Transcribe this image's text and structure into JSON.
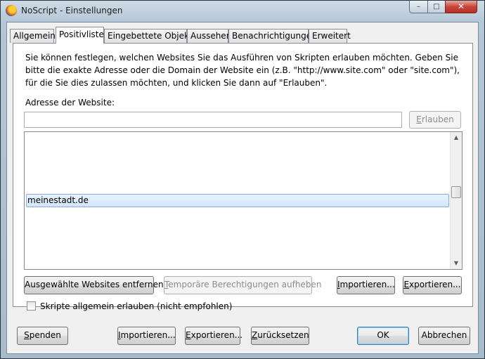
{
  "window": {
    "title": "NoScript - Einstellungen",
    "controls": {
      "minimize": "–",
      "maximize": "□",
      "close": "✕"
    }
  },
  "tabs": [
    {
      "label": "Allgemein"
    },
    {
      "label": "Positivliste",
      "active": true
    },
    {
      "label": "Eingebettete Objekte"
    },
    {
      "label": "Aussehen"
    },
    {
      "label": "Benachrichtigungen"
    },
    {
      "label": "Erweitert"
    }
  ],
  "whitelist": {
    "description": "Sie können festlegen, welchen Websites Sie das Ausführen von Skripten erlauben möchten. Geben Sie bitte die exakte Adresse oder die Domain der Website ein (z.B. \"http://www.site.com\" oder \"site.com\"), für die Sie dies zulassen möchten, und klicken Sie dann auf \"Erlauben\".",
    "address_label": "Adresse der Website:",
    "address_value": "",
    "allow_button": {
      "mnemonic": "E",
      "rest": "rlauben",
      "disabled": true
    },
    "sites": [
      "meinestadt.de"
    ],
    "remove_button": "Ausgewählte Websites entfernen",
    "temp_button": {
      "mnemonic": "T",
      "rest": "emporäre Berechtigungen aufheben",
      "disabled": true
    },
    "import_button": {
      "mnemonic": "I",
      "rest": "mportieren..."
    },
    "export_button": {
      "mnemonic": "E",
      "rest": "xportieren..."
    },
    "global_allow": {
      "label": "Skripte allgemein erlauben (nicht empfohlen)",
      "checked": false
    }
  },
  "footer": {
    "donate": {
      "mnemonic": "S",
      "rest": "penden"
    },
    "import": {
      "mnemonic": "I",
      "rest": "mportieren..."
    },
    "export": {
      "mnemonic": "E",
      "rest": "xportieren..."
    },
    "reset": {
      "mnemonic": "Z",
      "rest": "urücksetzen"
    },
    "ok": "OK",
    "cancel": "Abbrechen"
  },
  "icons": {
    "app": "firefox-icon",
    "scroll_up": "▲",
    "scroll_down": "▼"
  }
}
